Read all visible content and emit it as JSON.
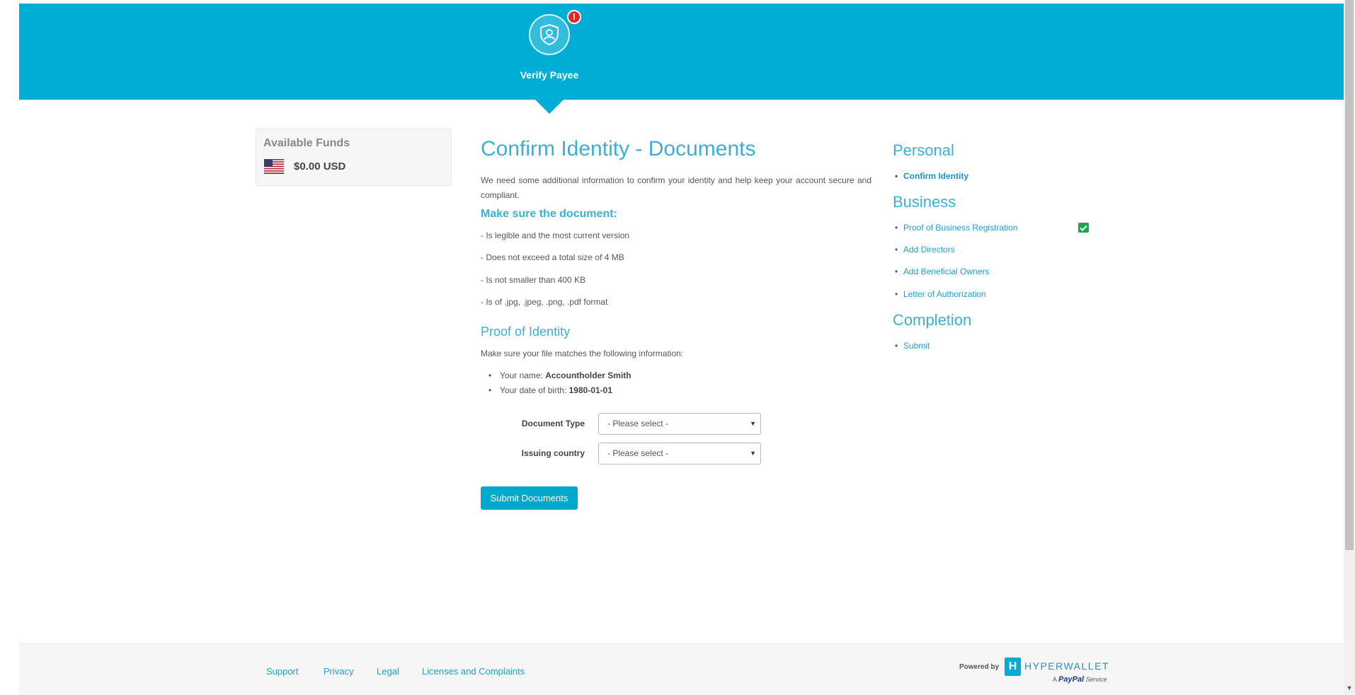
{
  "header": {
    "step_label": "Verify Payee",
    "alert_symbol": "!",
    "step_icon": "shield-user-icon",
    "color": "#00add4"
  },
  "funds": {
    "title": "Available Funds",
    "amount": "$0.00 USD",
    "flag_icon": "us-flag-icon"
  },
  "main": {
    "title": "Confirm Identity - Documents",
    "intro": "We need some additional information to confirm your identity and help keep your account secure and compliant.",
    "make_sure_heading": "Make sure the document:",
    "requirements": [
      "- Is legible and the most current version",
      "- Does not exceed a total size of 4 MB",
      "- Is not smaller than 400 KB",
      "- Is of .jpg, .jpeg, .png, .pdf format"
    ],
    "proof_heading": "Proof of Identity",
    "proof_intro": "Make sure your file matches the following information:",
    "name_label": "Your name: ",
    "name_value": "Accountholder Smith",
    "dob_label": "Your date of birth: ",
    "dob_value": "1980-01-01",
    "document_type_label": "Document Type",
    "document_type_value": "- Please select -",
    "issuing_country_label": "Issuing country",
    "issuing_country_value": "- Please select -",
    "submit_label": "Submit Documents"
  },
  "nav": {
    "personal_heading": "Personal",
    "personal_items": [
      "Confirm Identity"
    ],
    "business_heading": "Business",
    "business_items": [
      "Proof of Business Registration",
      "Add Directors",
      "Add Beneficial Owners",
      "Letter of Authorization"
    ],
    "completion_heading": "Completion",
    "completion_items": [
      "Submit"
    ],
    "completed_icon": "check-icon",
    "completed_color": "#1aa74b"
  },
  "footer": {
    "links": [
      "Support",
      "Privacy",
      "Legal",
      "Licenses and Complaints"
    ],
    "powered_by": "Powered by",
    "brand_name": "HYPERWALLET",
    "brand_initial": "H",
    "paypal_prefix": "A",
    "paypal_name": "PayPal",
    "paypal_suffix": "Service"
  }
}
